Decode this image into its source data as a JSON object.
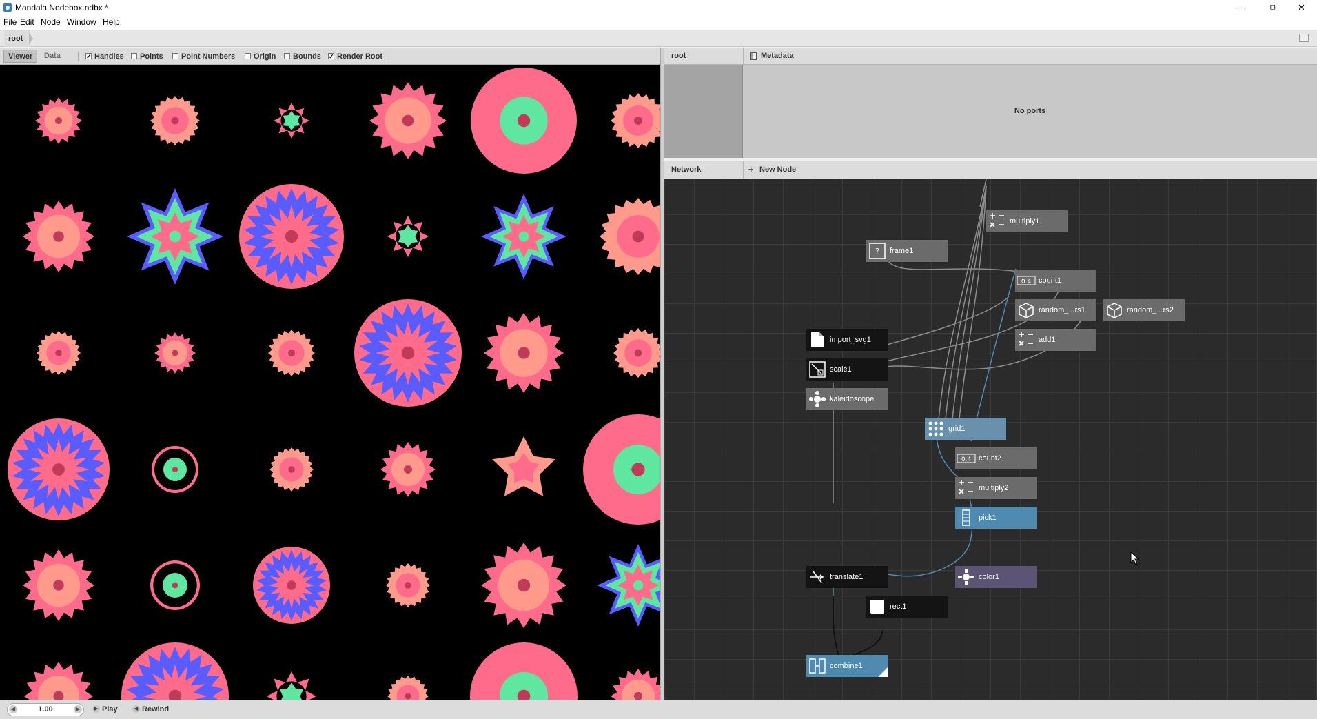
{
  "window": {
    "title": "Mandala Nodebox.ndbx *",
    "controls": [
      "minimize",
      "restore",
      "close"
    ]
  },
  "menu": [
    "File",
    "Edit",
    "Node",
    "Window",
    "Help"
  ],
  "breadcrumb": [
    "root"
  ],
  "viewer_toolbar": {
    "tabs": [
      {
        "label": "Viewer",
        "active": true
      },
      {
        "label": "Data",
        "active": false
      }
    ],
    "options": [
      {
        "label": "Handles",
        "checked": true
      },
      {
        "label": "Points",
        "checked": false
      },
      {
        "label": "Point Numbers",
        "checked": false
      },
      {
        "label": "Origin",
        "checked": false
      },
      {
        "label": "Bounds",
        "checked": false
      },
      {
        "label": "Render Root",
        "checked": true
      }
    ]
  },
  "colors": {
    "pink": "#ff6b8a",
    "salmon": "#ff9a8c",
    "mint": "#5fe6a0",
    "blue": "#5a5cff",
    "dark_pink": "#c23a5a",
    "node_selected": "#4f8bb0",
    "node_color": "#5b5474"
  },
  "port_panel": {
    "node_label": "root",
    "metadata_label": "Metadata",
    "empty_text": "No ports"
  },
  "network_panel": {
    "title": "Network",
    "new_node_label": "New Node",
    "nodes": [
      {
        "name": "multiply1",
        "icon": "math-icon",
        "style": "grey"
      },
      {
        "name": "frame1",
        "icon": "frame-icon",
        "style": "grey"
      },
      {
        "name": "count1",
        "icon": "count-icon",
        "style": "grey"
      },
      {
        "name": "random_...rs1",
        "icon": "cube-icon",
        "style": "grey"
      },
      {
        "name": "random_...rs2",
        "icon": "cube-icon",
        "style": "grey"
      },
      {
        "name": "add1",
        "icon": "math-icon",
        "style": "grey"
      },
      {
        "name": "import_svg1",
        "icon": "document-icon",
        "style": "dark"
      },
      {
        "name": "scale1",
        "icon": "scale-icon",
        "style": "dark"
      },
      {
        "name": "kaleidoscope",
        "icon": "kaleidoscope-icon",
        "style": "grey"
      },
      {
        "name": "grid1",
        "icon": "grid-icon",
        "style": "lightblue"
      },
      {
        "name": "count2",
        "icon": "count-icon",
        "style": "grey"
      },
      {
        "name": "multiply2",
        "icon": "math-icon",
        "style": "grey"
      },
      {
        "name": "pick1",
        "icon": "pick-icon",
        "style": "blue"
      },
      {
        "name": "translate1",
        "icon": "translate-icon",
        "style": "dark"
      },
      {
        "name": "color1",
        "icon": "color-icon",
        "style": "purple"
      },
      {
        "name": "rect1",
        "icon": "rect-icon",
        "style": "dark"
      },
      {
        "name": "combine1",
        "icon": "combine-icon",
        "style": "blue"
      }
    ],
    "count_icon_text": "0.4"
  },
  "playback": {
    "frame": "1.00",
    "play_label": "Play",
    "rewind_label": "Rewind"
  }
}
